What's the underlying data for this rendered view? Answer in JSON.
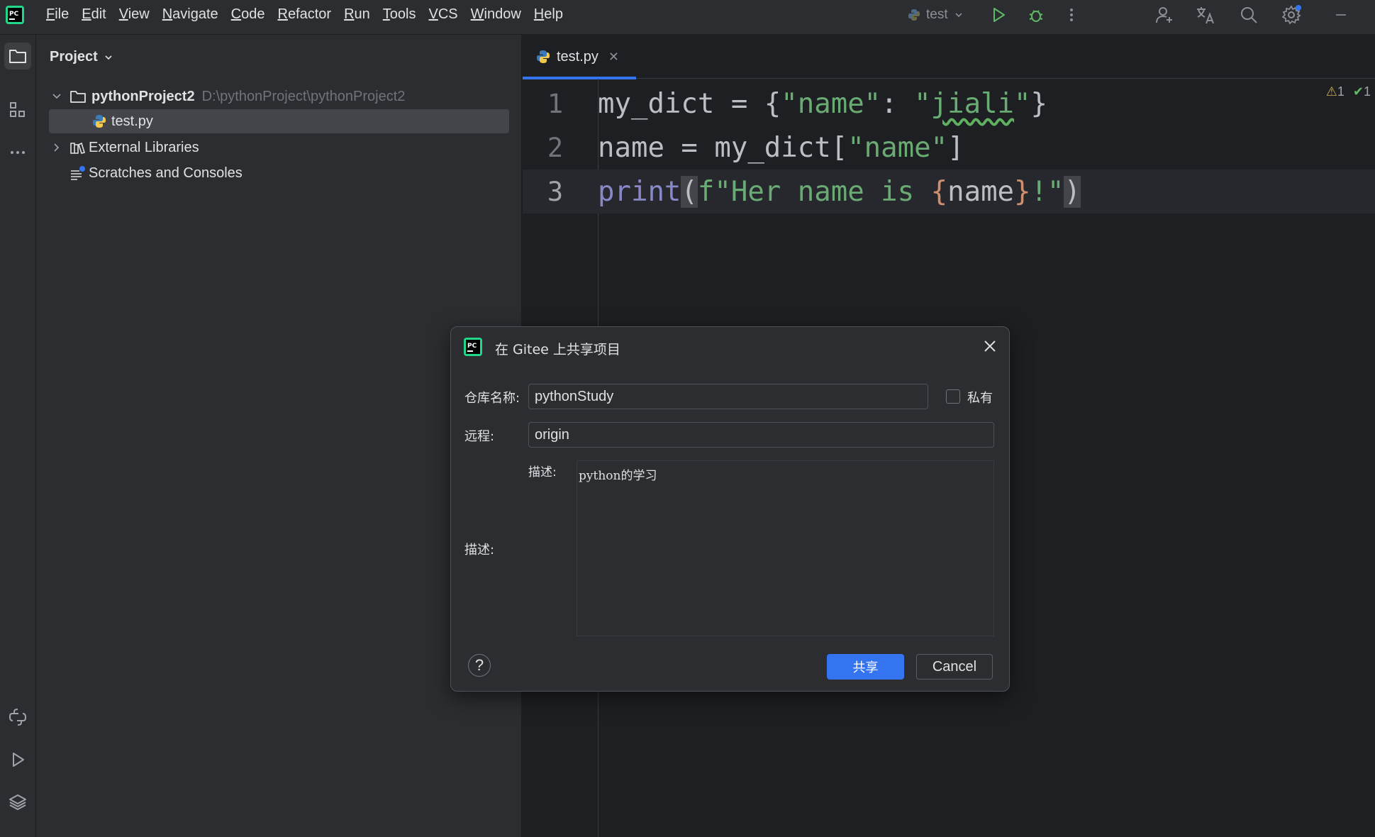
{
  "menu": {
    "items": [
      {
        "mn": "F",
        "rest": "ile"
      },
      {
        "mn": "E",
        "rest": "dit"
      },
      {
        "mn": "V",
        "rest": "iew"
      },
      {
        "mn": "N",
        "rest": "avigate"
      },
      {
        "mn": "C",
        "rest": "ode"
      },
      {
        "mn": "R",
        "rest": "efactor"
      },
      {
        "mn": "R",
        "rest": "un"
      },
      {
        "mn": "T",
        "rest": "ools"
      },
      {
        "mn": "V",
        "rest": "CS"
      },
      {
        "mn": "W",
        "rest": "indow"
      },
      {
        "mn": "H",
        "rest": "elp"
      }
    ]
  },
  "toolbar": {
    "run_config": "test"
  },
  "project": {
    "title": "Project",
    "root_name": "pythonProject2",
    "root_path": "D:\\pythonProject\\pythonProject2",
    "file": "test.py",
    "external": "External Libraries",
    "scratches": "Scratches and Consoles"
  },
  "editor": {
    "tab": "test.py",
    "warnings": "1",
    "checks": "1",
    "line_numbers": [
      "1",
      "2",
      "3"
    ],
    "line1": {
      "a": "my_dict = {",
      "b": "\"name\"",
      "c": ": ",
      "d": "\"",
      "e": "jiali",
      "f": "\"",
      "g": "}"
    },
    "line2": {
      "a": "name = my_dict[",
      "b": "\"name\"",
      "c": "]"
    },
    "line3": {
      "a": "print",
      "b": "(",
      "c": "f\"Her name is ",
      "d": "{",
      "e": "name",
      "f": "}",
      "g": "!\"",
      "h": ")"
    }
  },
  "dialog": {
    "title": "在 Gitee 上共享项目",
    "repo_label": "仓库名称:",
    "repo_value": "pythonStudy",
    "private_label": "私有",
    "remote_label": "远程:",
    "remote_value": "origin",
    "desc_label_outer": "描述:",
    "desc_label_inner": "描述:",
    "desc_value": "python的学习",
    "help": "?",
    "share_button": "共享",
    "cancel_button": "Cancel"
  },
  "colors": {
    "accent": "#3574f0",
    "background": "#1e1f22",
    "panel": "#2b2d30"
  }
}
